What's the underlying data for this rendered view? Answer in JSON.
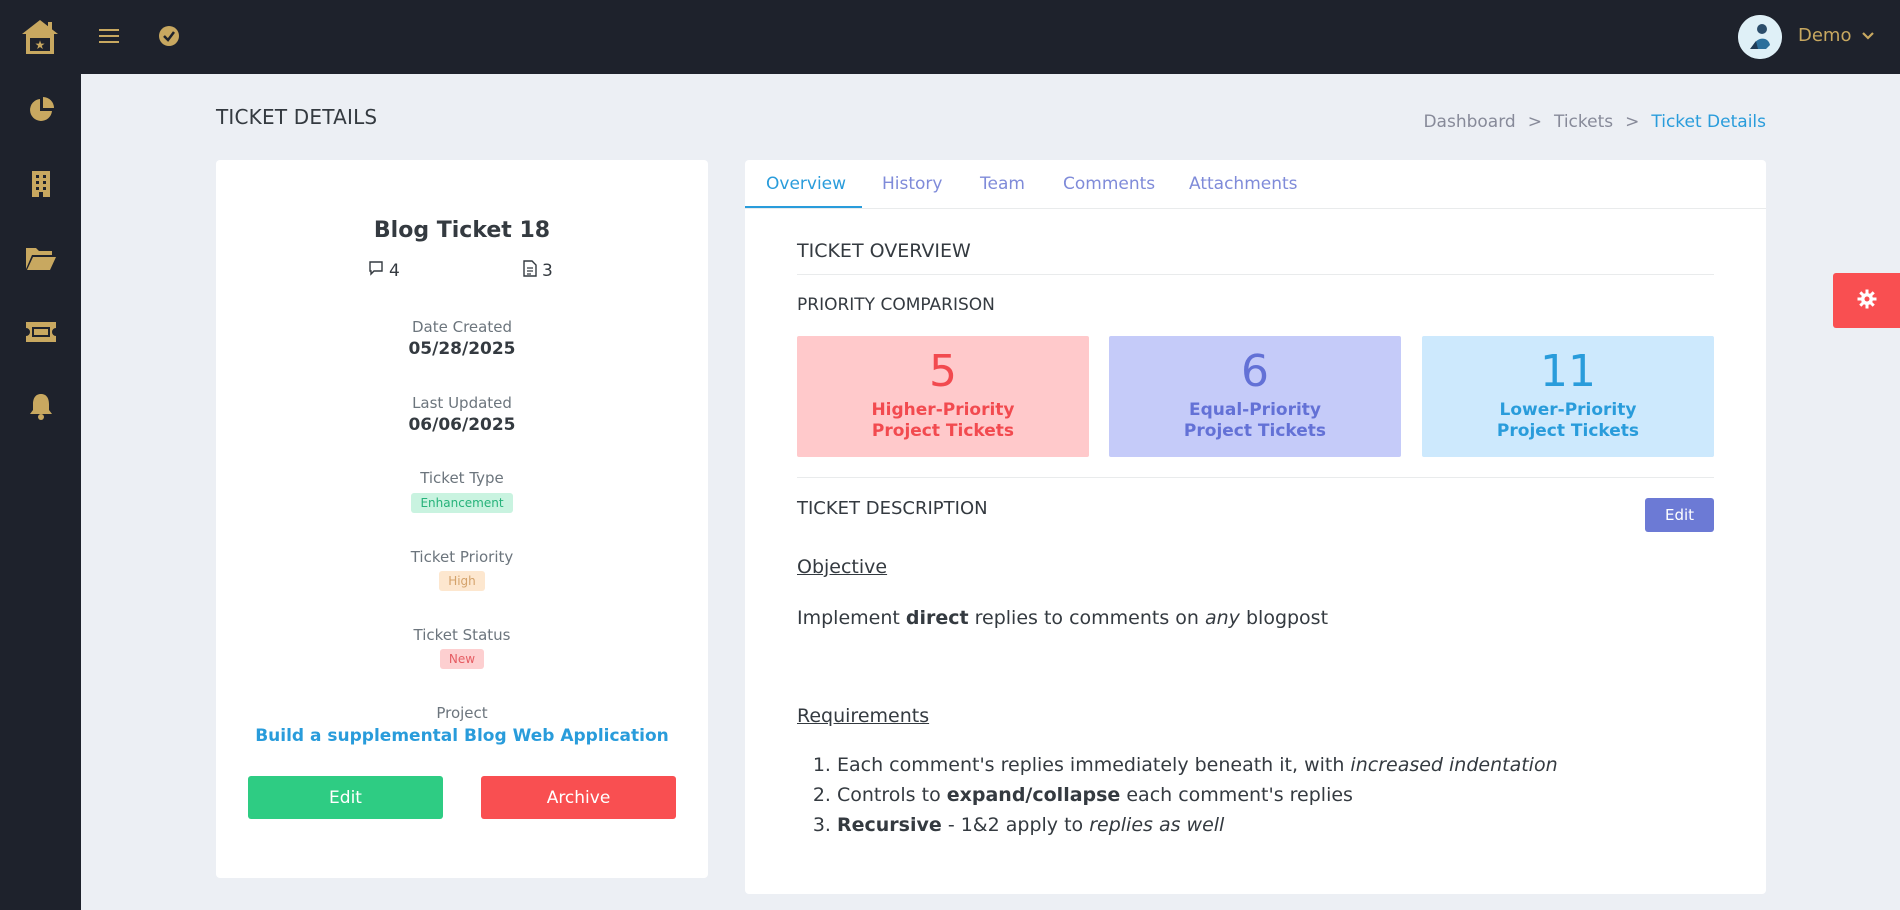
{
  "topbar": {
    "user_name": "Demo"
  },
  "page": {
    "title": "TICKET DETAILS",
    "breadcrumb": [
      {
        "label": "Dashboard"
      },
      {
        "label": "Tickets"
      },
      {
        "label": "Ticket Details"
      }
    ],
    "breadcrumb_sep": ">"
  },
  "ticket": {
    "title": "Blog Ticket 18",
    "comments_count": "4",
    "attachments_count": "3",
    "date_created_label": "Date Created",
    "date_created": "05/28/2025",
    "last_updated_label": "Last Updated",
    "last_updated": "06/06/2025",
    "type_label": "Ticket Type",
    "type": "Enhancement",
    "priority_label": "Ticket Priority",
    "priority": "High",
    "status_label": "Ticket Status",
    "status": "New",
    "project_label": "Project",
    "project": "Build a supplemental Blog Web Application",
    "edit_label": "Edit",
    "archive_label": "Archive"
  },
  "tabs": [
    {
      "label": "Overview",
      "active": true
    },
    {
      "label": "History"
    },
    {
      "label": "Team"
    },
    {
      "label": "Comments"
    },
    {
      "label": "Attachments"
    }
  ],
  "overview": {
    "heading": "TICKET OVERVIEW",
    "priority_heading": "PRIORITY COMPARISON",
    "stats": [
      {
        "value": "5",
        "line1": "Higher-Priority",
        "line2": "Project Tickets",
        "color": "#f24a4f"
      },
      {
        "value": "6",
        "line1": "Equal-Priority",
        "line2": "Project Tickets",
        "color": "#6371d6"
      },
      {
        "value": "11",
        "line1": "Lower-Priority",
        "line2": "Project Tickets",
        "color": "#299cdb"
      }
    ],
    "description_heading": "TICKET DESCRIPTION",
    "description_edit": "Edit",
    "objective_heading": "Objective",
    "objective": {
      "pre": "Implement ",
      "bold": "direct",
      "mid": " replies to comments on ",
      "italic": "any",
      "post": " blogpost"
    },
    "requirements_heading": "Requirements",
    "requirements": [
      {
        "pre": "Each comment's replies immediately beneath it, with ",
        "italic": "increased indentation"
      },
      {
        "pre": "Controls to ",
        "bold": "expand/collapse",
        "post": " each comment's replies"
      },
      {
        "bold": "Recursive",
        "pre": " - 1&2 apply to ",
        "italic": "replies as well"
      }
    ]
  },
  "colors": {
    "sidebar_bg": "#1e222c",
    "accent_gold": "#c8a860",
    "link_blue": "#299cdb",
    "success": "#2ecc83",
    "danger": "#f94f51"
  }
}
